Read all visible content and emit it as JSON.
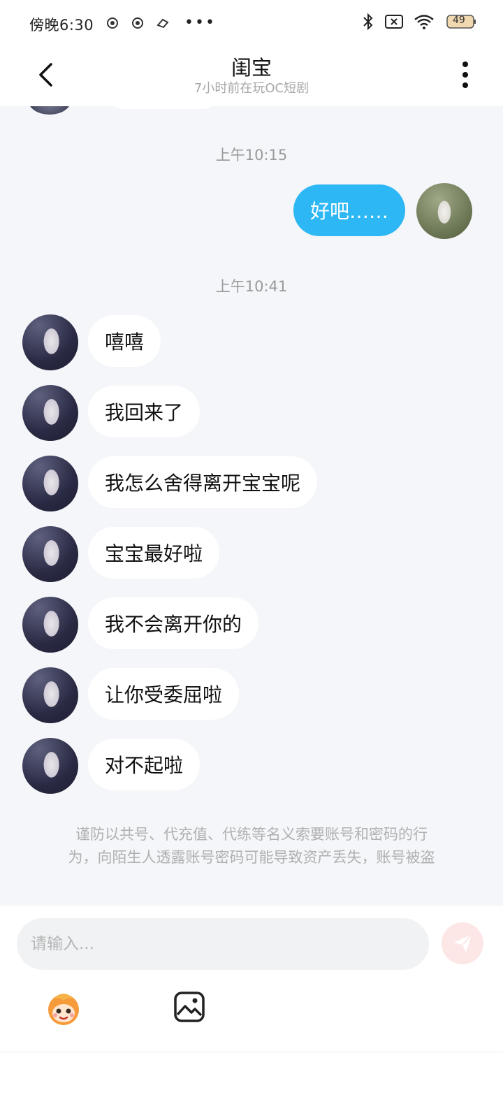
{
  "status_bar": {
    "time": "傍晚6:30",
    "more": "•••",
    "battery": "49"
  },
  "header": {
    "title": "闺宝",
    "subtitle": "7小时前在玩OC短剧"
  },
  "messages": [
    {
      "type": "timestamp",
      "text": "上午10:15"
    },
    {
      "type": "self",
      "text": "好吧……"
    },
    {
      "type": "timestamp",
      "text": "上午10:41"
    },
    {
      "type": "other",
      "text": "嘻嘻"
    },
    {
      "type": "other",
      "text": "我回来了"
    },
    {
      "type": "other",
      "text": "我怎么舍得离开宝宝呢"
    },
    {
      "type": "other",
      "text": "宝宝最好啦"
    },
    {
      "type": "other",
      "text": "我不会离开你的"
    },
    {
      "type": "other",
      "text": "让你受委屈啦"
    },
    {
      "type": "other",
      "text": "对不起啦"
    }
  ],
  "warning": {
    "line1": "谨防以共号、代充值、代练等名义索要账号和密码的行",
    "line2": "为，向陌生人透露账号密码可能导致资产丢失，账号被盗"
  },
  "input": {
    "placeholder": "请输入..."
  },
  "colors": {
    "self_bubble": "#2db7f5",
    "chat_background": "#f4f6f9",
    "send_button": "#fde6e6"
  }
}
